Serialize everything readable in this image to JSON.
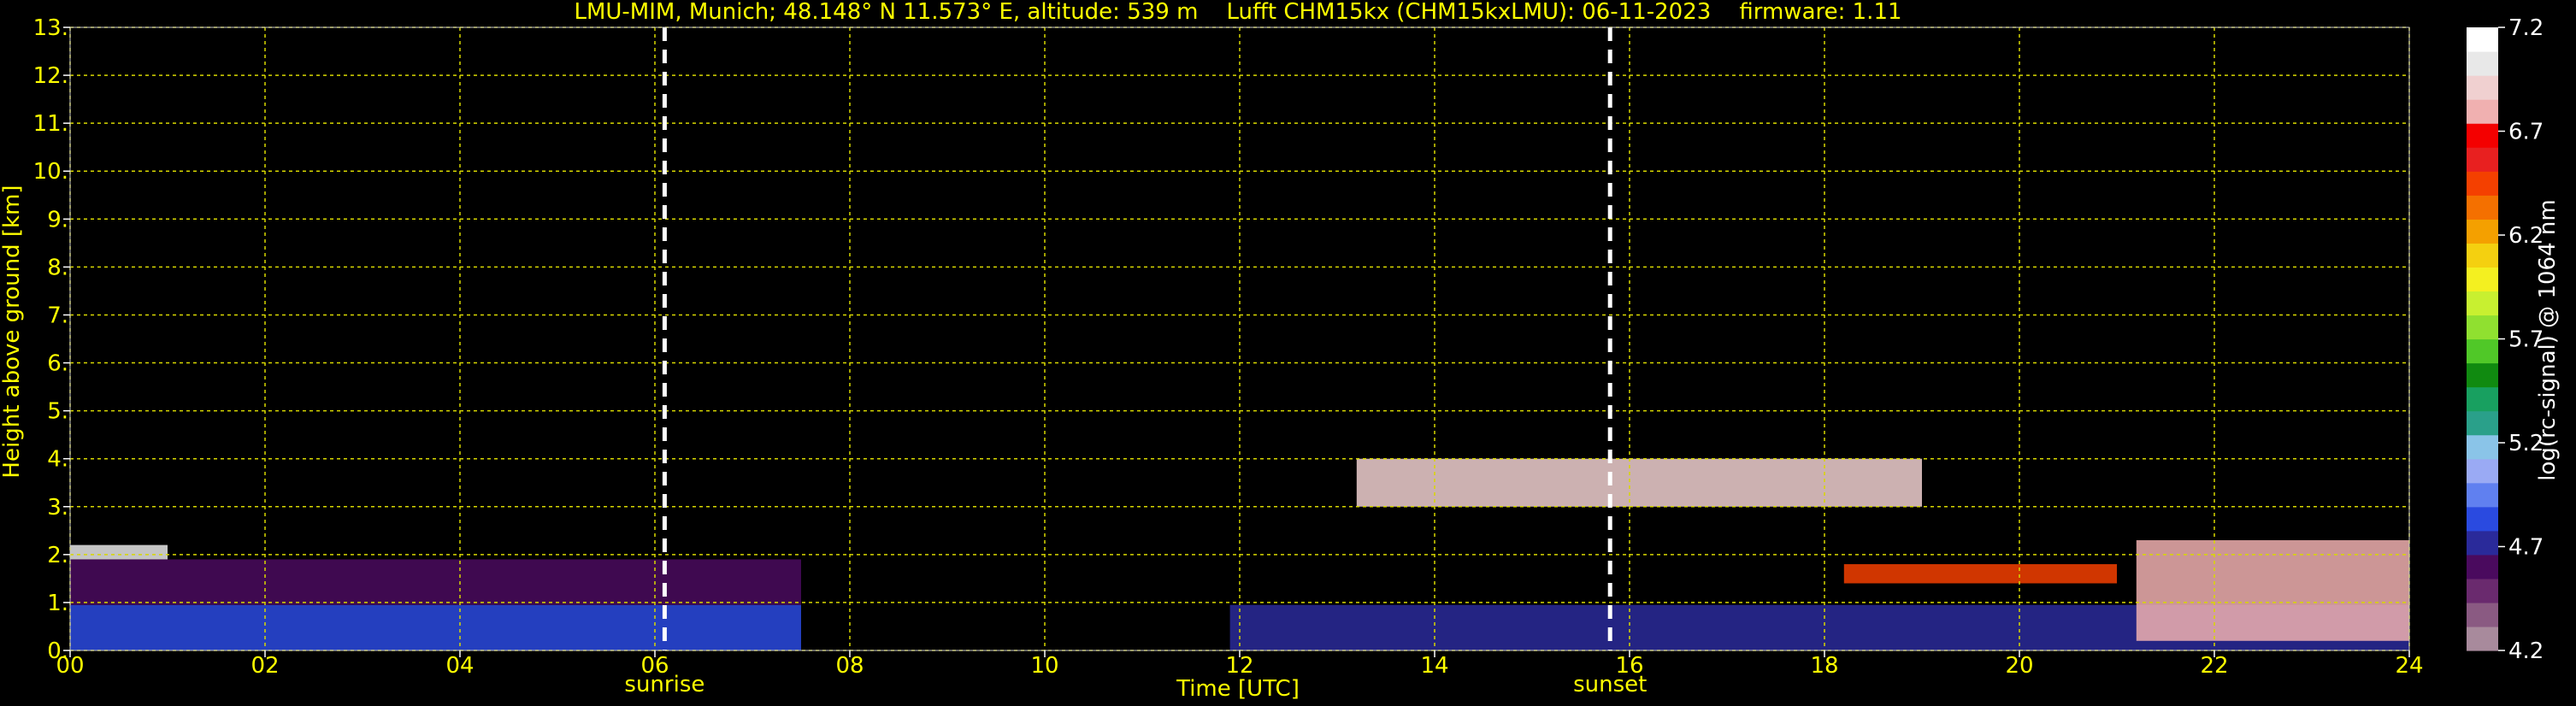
{
  "chart_data": {
    "type": "heatmap",
    "title": "LMU-MIM, Munich; 48.148° N 11.573° E, altitude: 539 m    Lufft CHM15kx (CHM15kxLMU): 06-11-2023    firmware: 1.11",
    "xlabel": "Time [UTC]",
    "ylabel": "Height above ground [km]",
    "x_ticks": [
      "00",
      "02",
      "04",
      "06",
      "08",
      "10",
      "12",
      "14",
      "16",
      "18",
      "20",
      "22",
      "24"
    ],
    "y_ticks": [
      "0.",
      "1.",
      "2.",
      "3.",
      "4.",
      "5.",
      "6.",
      "7.",
      "8.",
      "9.",
      "10.",
      "11.",
      "12.",
      "13."
    ],
    "xlim": [
      0,
      24
    ],
    "ylim": [
      0,
      13
    ],
    "grid": true,
    "no_data_interval": [
      7.5,
      11.9
    ],
    "events": [
      {
        "label": "sunrise",
        "time": 6.1
      },
      {
        "label": "sunset",
        "time": 15.8
      }
    ],
    "colorbar": {
      "label": "log(rc-signal) @ 1064 nm",
      "range": [
        4.2,
        7.2
      ],
      "ticks": [
        "4.2",
        "4.7",
        "5.2",
        "5.7",
        "6.2",
        "6.7",
        "7.2"
      ],
      "tick_values": [
        4.2,
        4.7,
        5.2,
        5.7,
        6.2,
        6.7,
        7.2
      ],
      "colors": [
        "#a88a9c",
        "#8a5a82",
        "#6a2a6e",
        "#4a0a5e",
        "#2a2a9a",
        "#2a4ae0",
        "#6080f0",
        "#9aaaf4",
        "#8ac4e8",
        "#2aa08a",
        "#18a060",
        "#108a10",
        "#50c828",
        "#90e030",
        "#c8f030",
        "#f4f020",
        "#f4d010",
        "#f4a000",
        "#f47000",
        "#f44000",
        "#e82020",
        "#f40000",
        "#f0b0b0",
        "#f0d0d0",
        "#e8e8e8",
        "#ffffff"
      ]
    },
    "layers": [
      {
        "t0": 0.0,
        "t1": 7.5,
        "h0": 0.0,
        "h1": 0.95,
        "level": 4.85
      },
      {
        "t0": 0.0,
        "t1": 7.5,
        "h0": 0.95,
        "h1": 1.9,
        "level": 4.55
      },
      {
        "t0": 0.0,
        "t1": 1.0,
        "h0": 1.9,
        "h1": 2.2,
        "level": 7.0
      },
      {
        "t0": 11.9,
        "t1": 24.0,
        "h0": 0.0,
        "h1": 0.95,
        "level": 4.7
      },
      {
        "t0": 13.2,
        "t1": 19.0,
        "h0": 3.0,
        "h1": 4.0,
        "level": 6.9
      },
      {
        "t0": 18.2,
        "t1": 21.0,
        "h0": 1.4,
        "h1": 1.8,
        "level": 6.4
      },
      {
        "t0": 21.2,
        "t1": 24.0,
        "h0": 0.2,
        "h1": 2.3,
        "level": 6.8
      }
    ]
  }
}
